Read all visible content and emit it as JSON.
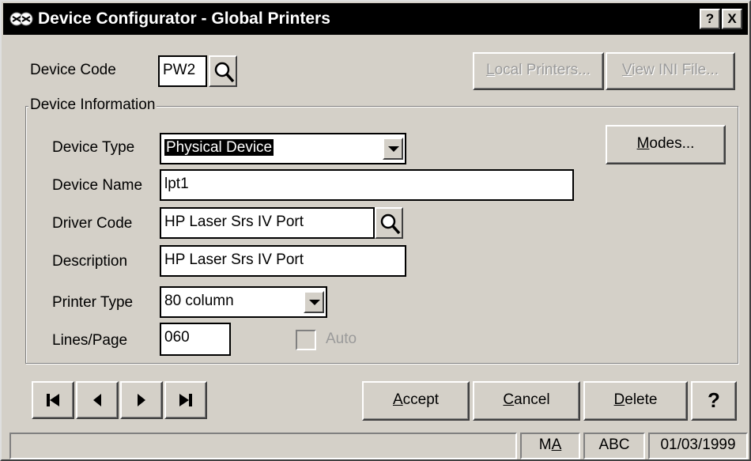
{
  "window": {
    "title": "Device Configurator - Global Printers",
    "help_button": "?",
    "close_button": "X",
    "icon": "app-icon"
  },
  "header": {
    "device_code_label": "Device Code",
    "device_code_value": "PW2",
    "local_printers_button": {
      "label": "Local Printers...",
      "mnemonic": "L",
      "rest": "ocal Printers...",
      "enabled": false
    },
    "view_ini_button": {
      "label": "View INI File...",
      "mnemonic": "V",
      "rest": "iew INI File...",
      "enabled": false
    }
  },
  "device_information": {
    "group_title": "Device Information",
    "device_type_label": "Device Type",
    "device_type_value": "Physical Device",
    "modes_button": {
      "label": "Modes...",
      "mnemonic": "M",
      "rest": "odes..."
    },
    "device_name_label": "Device Name",
    "device_name_value": "lpt1",
    "driver_code_label": "Driver Code",
    "driver_code_value": "HP Laser Srs IV Port",
    "description_label": "Description",
    "description_value": "HP Laser Srs IV Port",
    "printer_type_label": "Printer Type",
    "printer_type_value": "80 column",
    "lines_page_label": "Lines/Page",
    "lines_page_value": "060",
    "auto_label": "Auto",
    "auto_checked": false,
    "auto_enabled": false
  },
  "navigation": {
    "buttons": [
      "first-record-icon",
      "previous-record-icon",
      "next-record-icon",
      "last-record-icon"
    ]
  },
  "actions": {
    "accept": {
      "label": "Accept",
      "mnemonic": "A",
      "rest": "ccept"
    },
    "cancel": {
      "label": "Cancel",
      "mnemonic": "C",
      "rest": "ancel"
    },
    "delete": {
      "label": "Delete",
      "mnemonic": "D",
      "rest": "elete"
    },
    "help": "?"
  },
  "status": {
    "mode_prefix": "M",
    "mode_mnemonic": "A",
    "abc": "ABC",
    "date": "01/03/1999"
  },
  "colors": {
    "face": "#d4d0c8",
    "titlebar": "#000000",
    "disabled_text": "#9a9a9a",
    "highlight": "#000000"
  }
}
